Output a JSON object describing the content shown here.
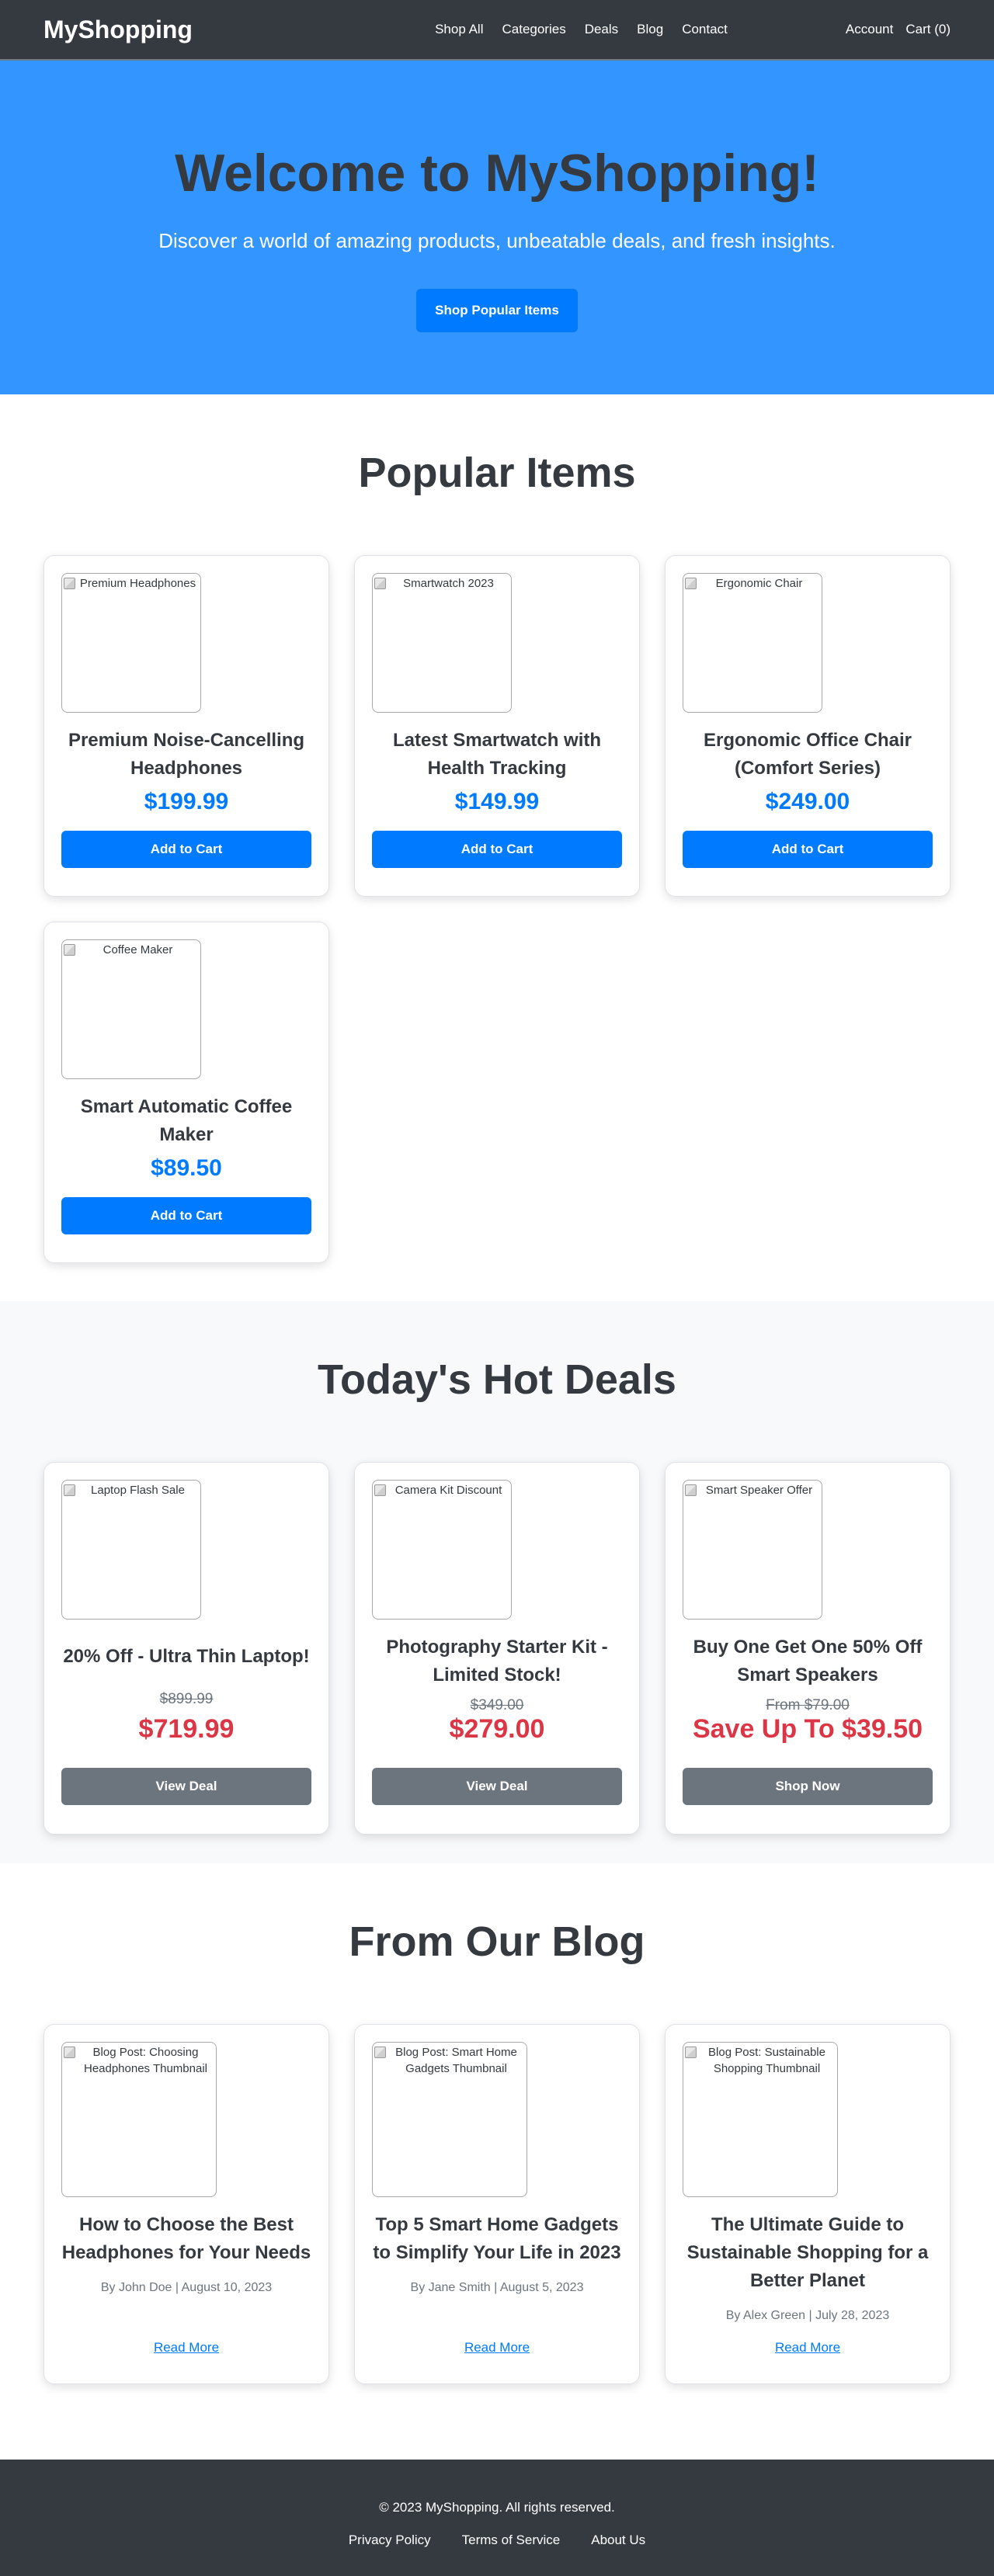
{
  "header": {
    "logo": "MyShopping",
    "nav": [
      "Shop All",
      "Categories",
      "Deals",
      "Blog",
      "Contact"
    ],
    "account": "Account",
    "cart": "Cart (0)"
  },
  "hero": {
    "title": "Welcome to MyShopping!",
    "subtitle": "Discover a world of amazing products, unbeatable deals, and fresh insights.",
    "cta": "Shop Popular Items"
  },
  "popular": {
    "title": "Popular Items",
    "items": [
      {
        "image_alt": "Premium Headphones",
        "name": "Premium Noise-Cancelling Headphones",
        "price": "$199.99",
        "button": "Add to Cart"
      },
      {
        "image_alt": "Smartwatch 2023",
        "name": "Latest Smartwatch with Health Tracking",
        "price": "$149.99",
        "button": "Add to Cart"
      },
      {
        "image_alt": "Ergonomic Chair",
        "name": "Ergonomic Office Chair (Comfort Series)",
        "price": "$249.00",
        "button": "Add to Cart"
      },
      {
        "image_alt": "Coffee Maker",
        "name": "Smart Automatic Coffee Maker",
        "price": "$89.50",
        "button": "Add to Cart"
      }
    ]
  },
  "deals": {
    "title": "Today's Hot Deals",
    "items": [
      {
        "image_alt": "Laptop Flash Sale",
        "name": "20% Off - Ultra Thin Laptop!",
        "old_price": "$899.99",
        "price": "$719.99",
        "button": "View Deal"
      },
      {
        "image_alt": "Camera Kit Discount",
        "name": "Photography Starter Kit - Limited Stock!",
        "old_price": "$349.00",
        "price": "$279.00",
        "button": "View Deal"
      },
      {
        "image_alt": "Smart Speaker Offer",
        "name": "Buy One Get One 50% Off Smart Speakers",
        "old_price": "From $79.00",
        "price": "Save Up To $39.50",
        "button": "Shop Now"
      }
    ]
  },
  "blog": {
    "title": "From Our Blog",
    "posts": [
      {
        "image_alt": "Blog Post: Choosing Headphones Thumbnail",
        "title": "How to Choose the Best Headphones for Your Needs",
        "meta": "By John Doe | August 10, 2023",
        "link": "Read More"
      },
      {
        "image_alt": "Blog Post: Smart Home Gadgets Thumbnail",
        "title": "Top 5 Smart Home Gadgets to Simplify Your Life in 2023",
        "meta": "By Jane Smith | August 5, 2023",
        "link": "Read More"
      },
      {
        "image_alt": "Blog Post: Sustainable Shopping Thumbnail",
        "title": "The Ultimate Guide to Sustainable Shopping for a Better Planet",
        "meta": "By Alex Green | July 28, 2023",
        "link": "Read More"
      }
    ]
  },
  "footer": {
    "copyright": "© 2023 MyShopping. All rights reserved.",
    "links": [
      "Privacy Policy",
      "Terms of Service",
      "About Us"
    ]
  },
  "colors": {
    "header_bg": "#343a40",
    "hero_bg": "#3395ff",
    "primary": "#007bff",
    "danger": "#dc3545",
    "secondary": "#6c757d",
    "deals_bg": "#f8f9fa"
  },
  "icons": {
    "broken_image": "broken-image-icon"
  }
}
